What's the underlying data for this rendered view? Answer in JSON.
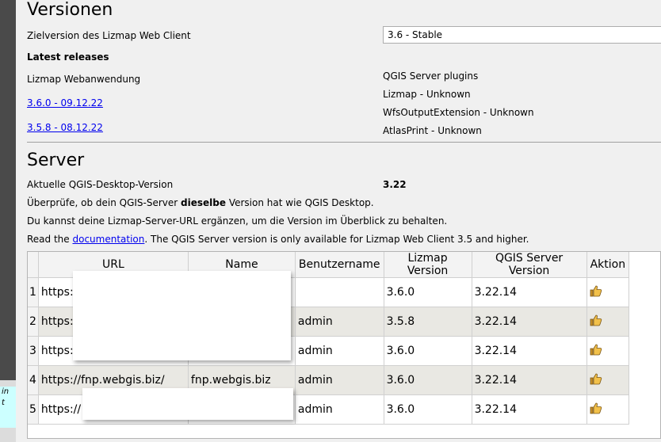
{
  "versions": {
    "title": "Versionen",
    "target_label": "Zielversion des Lizmap Web Client",
    "target_value": "3.6 - Stable",
    "latest_releases": "Latest releases",
    "lwc_label": "Lizmap Webanwendung",
    "release_links": [
      "3.6.0 - 09.12.22",
      "3.5.8 - 08.12.22"
    ],
    "plugins_label": "QGIS Server plugins",
    "plugins": [
      "Lizmap - Unknown",
      "WfsOutputExtension - Unknown",
      "AtlasPrint - Unknown"
    ]
  },
  "server": {
    "title": "Server",
    "desktop_version_label": "Aktuelle QGIS-Desktop-Version",
    "desktop_version_value": "3.22",
    "check_text_pre": "Überprüfe, ob dein QGIS-Server ",
    "check_text_bold": "dieselbe",
    "check_text_post": " Version hat wie QGIS Desktop.",
    "add_url_text": "Du kannst deine Lizmap-Server-URL ergänzen, um die Version im Überblick zu behalten.",
    "read_pre": "Read the ",
    "read_link": "documentation",
    "read_post": ". The QGIS Server version is only available for Lizmap Web Client 3.5 and higher."
  },
  "table": {
    "headers": [
      "URL",
      "Name",
      "Benutzername",
      "Lizmap Version",
      "QGIS Server Version",
      "Aktion"
    ],
    "rows": [
      {
        "num": "1",
        "url": "https:/",
        "name": "",
        "user": "",
        "lizmap": "3.6.0",
        "qgis": "3.22.14"
      },
      {
        "num": "2",
        "url": "https:/",
        "name": "",
        "user": "admin",
        "lizmap": "3.5.8",
        "qgis": "3.22.14"
      },
      {
        "num": "3",
        "url": "https:/",
        "name": "",
        "user": "admin",
        "lizmap": "3.6.0",
        "qgis": "3.22.14"
      },
      {
        "num": "4",
        "url": "https://fnp.webgis.biz/",
        "name": "fnp.webgis.biz",
        "user": "admin",
        "lizmap": "3.6.0",
        "qgis": "3.22.14"
      },
      {
        "num": "5",
        "url": "https://",
        "name": "",
        "user": "admin",
        "lizmap": "3.6.0",
        "qgis": "3.22.14"
      }
    ]
  },
  "left_note": "in\nt",
  "colors": {
    "link": "#0000ee",
    "alt_row": "#e9e8e3",
    "thumb": "#e8b030"
  }
}
